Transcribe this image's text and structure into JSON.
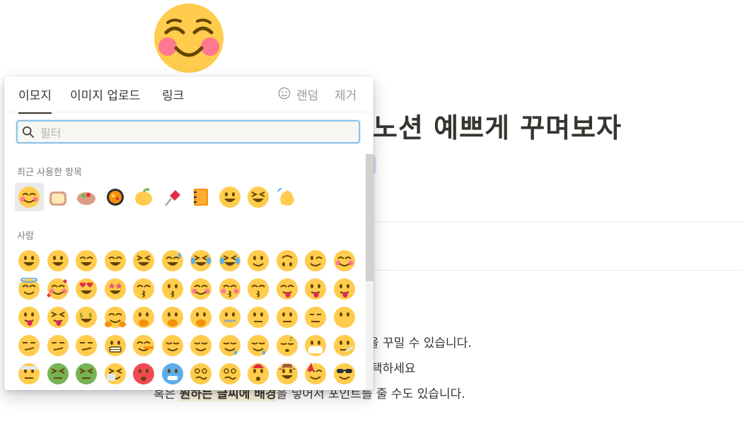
{
  "page": {
    "title": "노션 예쁘게 꾸며보자",
    "icon_name": "smiling-face-with-smiling-eyes-icon",
    "body_lines": [
      {
        "pre": "",
        "text": "을 꾸밀 수 있습니다."
      },
      {
        "pre": "",
        "text": "택하세요"
      },
      {
        "pre": "혹은 ",
        "highlight": "원하는 글씨에 배경",
        "text": "을 넣어서 포인트를 줄 수도 있습니다."
      }
    ]
  },
  "picker": {
    "tabs": [
      {
        "label": "이모지",
        "active": true
      },
      {
        "label": "이미지 업로드",
        "active": false
      },
      {
        "label": "링크",
        "active": false
      }
    ],
    "random_label": "랜덤",
    "remove_label": "제거",
    "search": {
      "placeholder": "필터",
      "value": ""
    },
    "recent_label": "최근 사용한 항목",
    "people_label": "사람",
    "recent_emojis": [
      "smiling-face-blush",
      "bread",
      "burrito",
      "shallow-pan-of-food",
      "lemon",
      "pushpin",
      "notebook",
      "grinning-face",
      "squinting-face",
      "waving-hands"
    ],
    "people_rows": [
      [
        "grinning",
        "grinning-big-eyes",
        "grinning-smiling-eyes",
        "beaming",
        "squinting",
        "sweat-smile",
        "rolling-laughing",
        "tears-of-joy",
        "slightly-smiling",
        "upside-down",
        "winking",
        "smiling-blush"
      ],
      [
        "halo",
        "hearts",
        "heart-eyes",
        "star-struck",
        "kissing-heart",
        "kissing",
        "smiling-blush-2",
        "kissing-closed-eyes",
        "kissing-smiling",
        "yum",
        "tongue",
        "winking-tongue"
      ],
      [
        "zany",
        "squinting-tongue",
        "money-mouth",
        "hugging",
        "hand-over-mouth",
        "shushing",
        "thinking",
        "zipper",
        "raised-eyebrow",
        "neutral",
        "expressionless",
        "no-mouth"
      ],
      [
        "smirking",
        "unamused",
        "rolling-eyes",
        "grimacing",
        "lying",
        "relieved",
        "pensive",
        "sleepy",
        "drooling",
        "sleeping",
        "mask",
        "thermometer"
      ],
      [
        "bandage",
        "nauseated",
        "vomiting",
        "sneezing",
        "hot",
        "cold",
        "woozy",
        "dizzy",
        "exploding",
        "cowboy",
        "partying",
        "sunglasses"
      ]
    ]
  },
  "colors": {
    "face": "#ffcc4d",
    "face_dark": "#664500",
    "blush": "#ff7892",
    "accent_blue": "#8fc4e6",
    "text": "#37352f",
    "muted": "#9b9a97"
  }
}
